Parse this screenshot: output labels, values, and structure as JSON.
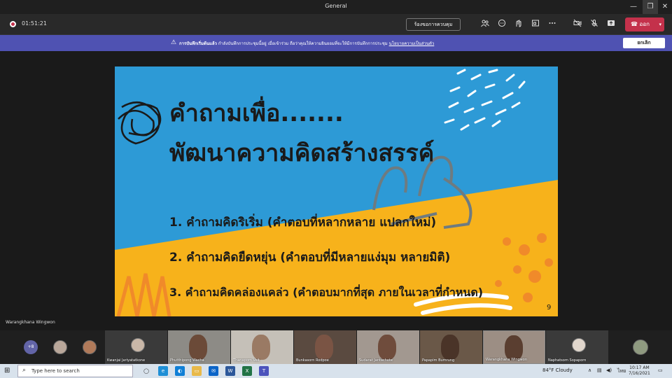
{
  "window": {
    "title": "General",
    "minimize": "—",
    "restore": "❐",
    "close": "✕"
  },
  "toolbar": {
    "elapsed": "01:51:21",
    "control_label": "ร้องขอการควบคุม",
    "icons": [
      "people-icon",
      "chat-icon",
      "react-icon",
      "rooms-icon",
      "more-icon",
      "camera-off-icon",
      "mic-off-icon",
      "share-icon"
    ],
    "leave_label": "ออก"
  },
  "banner": {
    "icon": "⚠",
    "bold": "การบันทึกเริ่มต้นแล้ว",
    "text": "กำลังบันทึกการประชุมนี้อยู่ เมื่อเข้าร่วม ถือว่าคุณให้ความยินยอมที่จะให้มีการบันทึกการประชุม",
    "link": "นโยบายความเป็นส่วนตัว",
    "dismiss_label": "ยกเลิก",
    "color": "#4f52b2"
  },
  "slide": {
    "title_line1": "คำถามเพื่อ.......",
    "title_line2": "พัฒนาความคิดสร้างสรรค์",
    "items": [
      "1. คำถามคิดริเริ่ม (คำตอบที่หลากหลาย แปลกใหม่)",
      "2. คำถามคิดยืดหยุ่น (คำตอบที่มีหลายแง่มุม หลายมิติ)",
      "3. คำถามคิดคล่องแคล่ว (คำตอบมากที่สุด ภายในเวลาที่กำหนด)"
    ],
    "page_number": "9",
    "colors": {
      "blue": "#2d9ad6",
      "yellow": "#f7b21b",
      "orange": "#f08a2a",
      "text": "#1a1a1a"
    }
  },
  "presenter": "Warangkhana Wingwon",
  "gallery": {
    "overflow_count": "+8",
    "tiles": [
      {
        "name": "Kwanjai Jariyatatkone",
        "type": "avatar"
      },
      {
        "name": "Phutthipong Wacha",
        "type": "video"
      },
      {
        "name": "Thanaporn Veit",
        "type": "video"
      },
      {
        "name": "Bunkasorn Rodpoe",
        "type": "video"
      },
      {
        "name": "Sudarat Jantachote",
        "type": "video"
      },
      {
        "name": "Papapim Bumrung",
        "type": "video"
      },
      {
        "name": "Warangkhana Wingwon",
        "type": "video"
      },
      {
        "name": "Naphatsorn Sopaporn",
        "type": "avatar"
      }
    ]
  },
  "taskbar": {
    "search_placeholder": "Type here to search",
    "weather": "84°F  Cloudy",
    "time": "10:17 AM",
    "date": "7/16/2021"
  }
}
